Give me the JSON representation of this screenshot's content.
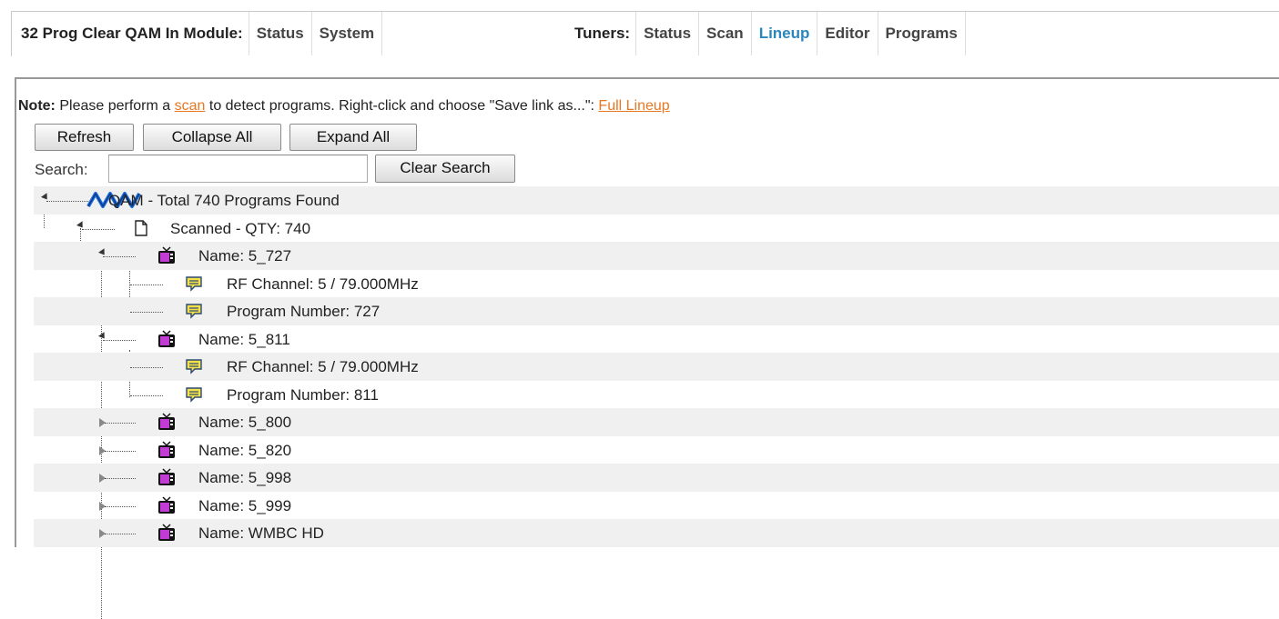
{
  "header": {
    "module_title": "32 Prog Clear QAM In Module:",
    "module_tabs": [
      "Status",
      "System"
    ],
    "tuners_title": "Tuners:",
    "tuner_tabs": [
      "Status",
      "Scan",
      "Lineup",
      "Editor",
      "Programs"
    ],
    "active_tab": "Lineup"
  },
  "note": {
    "label": "Note:",
    "text_before": " Please perform a ",
    "scan_link": "scan",
    "text_after": " to detect programs.  Right-click and choose \"Save link as...\": ",
    "lineup_link": "Full Lineup"
  },
  "buttons": {
    "refresh": "Refresh",
    "collapse_all": "Collapse All",
    "expand_all": "Expand All",
    "clear_search": "Clear Search"
  },
  "search": {
    "label": "Search:",
    "value": ""
  },
  "tree": {
    "root": "QAM - Total 740 Programs Found",
    "scanned": "Scanned - QTY: 740",
    "programs": [
      {
        "name": "Name: 5_727",
        "expanded": true,
        "rf": "RF Channel: 5 / 79.000MHz",
        "number": "Program Number: 727"
      },
      {
        "name": "Name: 5_811",
        "expanded": true,
        "rf": "RF Channel: 5 / 79.000MHz",
        "number": "Program Number: 811"
      },
      {
        "name": "Name: 5_800",
        "expanded": false
      },
      {
        "name": "Name: 5_820",
        "expanded": false
      },
      {
        "name": "Name: 5_998",
        "expanded": false
      },
      {
        "name": "Name: 5_999",
        "expanded": false
      },
      {
        "name": "Name: WMBC HD",
        "expanded": false
      }
    ]
  },
  "colors": {
    "active_tab": "#2a86bd",
    "link": "#e87722",
    "row_shade": "#f0f0f0"
  }
}
